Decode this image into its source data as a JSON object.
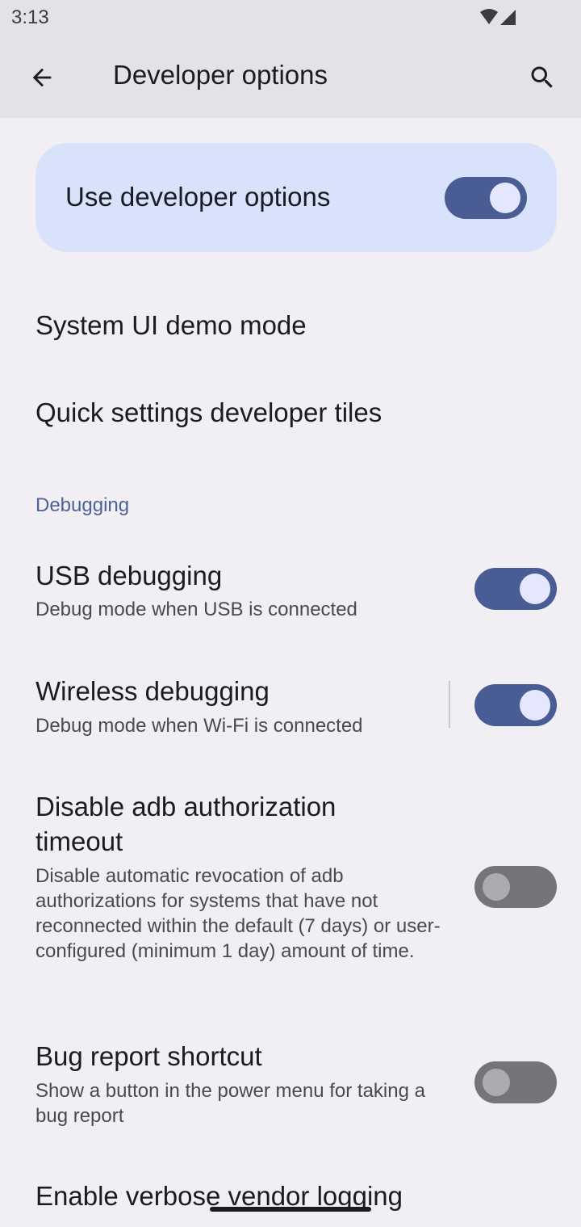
{
  "status_bar": {
    "time": "3:13",
    "icons": [
      "wifi-icon",
      "cell-signal-icon"
    ]
  },
  "app_bar": {
    "back_icon": "arrow-back-icon",
    "title": "Developer options",
    "search_icon": "search-icon"
  },
  "master_toggle": {
    "label": "Use developer options",
    "on": true
  },
  "items": [
    {
      "title": "System UI demo mode"
    },
    {
      "title": "Quick settings developer tiles"
    }
  ],
  "debugging_section": {
    "header": "Debugging",
    "items": [
      {
        "title": "USB debugging",
        "summary": "Debug mode when USB is connected",
        "on": true
      },
      {
        "title": "Wireless debugging",
        "summary": "Debug mode when Wi-Fi is connected",
        "on": true
      },
      {
        "title_line1": "Disable adb authorization",
        "title_line2": "timeout",
        "summary": "Disable automatic revocation of adb authorizations for systems that have not reconnected within the default (7 days) or user-configured (minimum 1 day) amount of time.",
        "on": false
      },
      {
        "title": "Bug report shortcut",
        "summary": "Show a button in the power menu for taking a bug report",
        "on": false
      },
      {
        "title": "Enable verbose vendor logging"
      }
    ]
  },
  "colors": {
    "switch_on_track": "#495d94",
    "switch_off_track": "#76747b",
    "section_header": "#4d6296",
    "master_card": "#d8e2fa"
  }
}
